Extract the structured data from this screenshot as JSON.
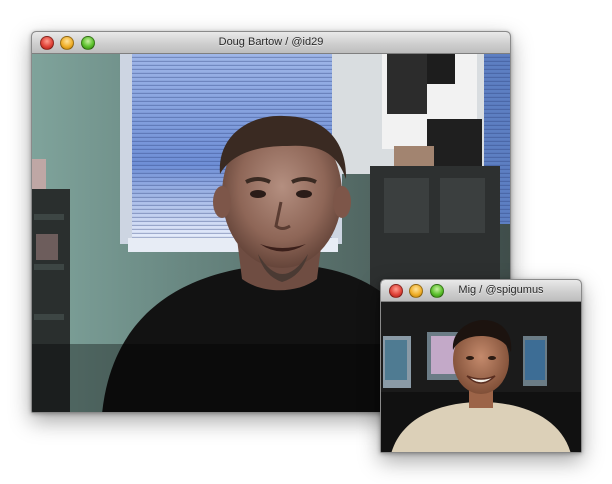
{
  "main_window": {
    "title": "Doug Bartow / @id29"
  },
  "pip_window": {
    "title": "Mig / @spigumus"
  }
}
